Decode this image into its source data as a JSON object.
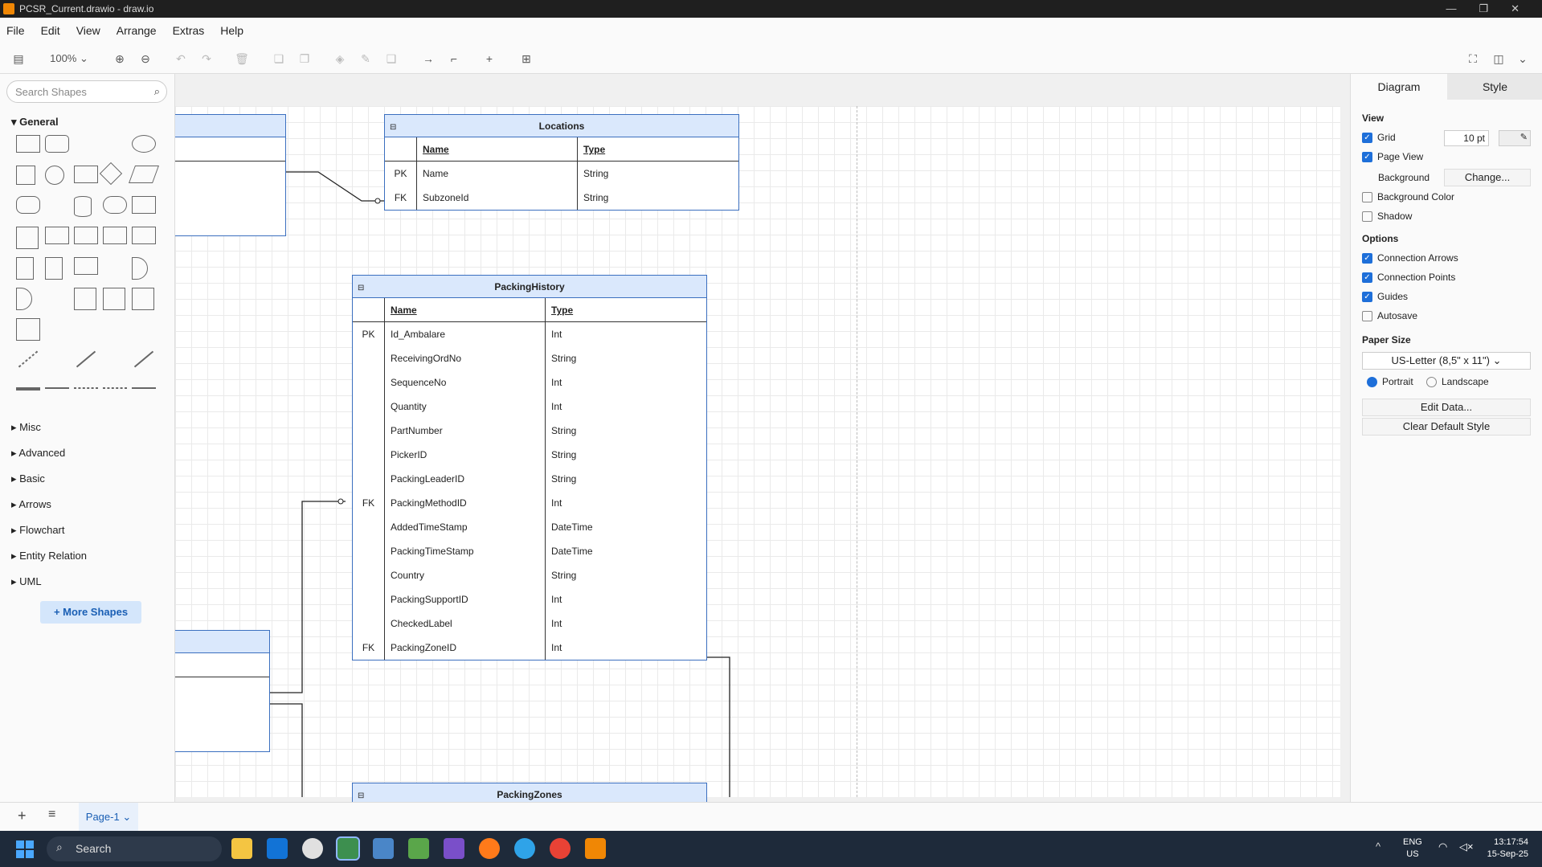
{
  "window": {
    "title": "PCSR_Current.drawio - draw.io"
  },
  "menu": [
    "File",
    "Edit",
    "View",
    "Arrange",
    "Extras",
    "Help"
  ],
  "toolbar": {
    "zoom": "100%"
  },
  "sidebar": {
    "search_placeholder": "Search Shapes",
    "general_label": "General",
    "sections": [
      "Misc",
      "Advanced",
      "Basic",
      "Arrows",
      "Flowchart",
      "Entity Relation",
      "UML"
    ],
    "more_shapes": "+ More Shapes"
  },
  "tables": {
    "locations": {
      "title": "Locations",
      "head": [
        "",
        "Name",
        "Type"
      ],
      "rows": [
        [
          "PK",
          "Name",
          "String"
        ],
        [
          "FK",
          "SubzoneId",
          "String"
        ]
      ]
    },
    "packing_history": {
      "title": "PackingHistory",
      "head": [
        "",
        "Name",
        "Type"
      ],
      "rows": [
        [
          "PK",
          "Id_Ambalare",
          "Int"
        ],
        [
          "",
          "ReceivingOrdNo",
          "String"
        ],
        [
          "",
          "SequenceNo",
          "Int"
        ],
        [
          "",
          "Quantity",
          "Int"
        ],
        [
          "",
          "PartNumber",
          "String"
        ],
        [
          "",
          "PickerID",
          "String"
        ],
        [
          "",
          "PackingLeaderID",
          "String"
        ],
        [
          "FK",
          "PackingMethodID",
          "Int"
        ],
        [
          "",
          "AddedTimeStamp",
          "DateTime"
        ],
        [
          "",
          "PackingTimeStamp",
          "DateTime"
        ],
        [
          "",
          "Country",
          "String"
        ],
        [
          "",
          "PackingSupportID",
          "Int"
        ],
        [
          "",
          "CheckedLabel",
          "Int"
        ],
        [
          "FK",
          "PackingZoneID",
          "Int"
        ]
      ]
    },
    "packing_zones": {
      "title": "PackingZones"
    }
  },
  "right_panel": {
    "tabs": [
      "Diagram",
      "Style"
    ],
    "view_label": "View",
    "grid": "Grid",
    "grid_size": "10 pt",
    "page_view": "Page View",
    "background": "Background",
    "change": "Change...",
    "background_color": "Background Color",
    "shadow": "Shadow",
    "options_label": "Options",
    "connection_arrows": "Connection Arrows",
    "connection_points": "Connection Points",
    "guides": "Guides",
    "autosave": "Autosave",
    "paper_size_label": "Paper Size",
    "paper_size": "US-Letter (8,5\" x 11\")",
    "portrait": "Portrait",
    "landscape": "Landscape",
    "edit_data": "Edit Data...",
    "clear_default_style": "Clear Default Style"
  },
  "bottom": {
    "page_tab": "Page-1"
  },
  "taskbar": {
    "search": "Search",
    "lang1": "ENG",
    "lang2": "US",
    "time": "13:17:54",
    "date": "15-Sep-25"
  }
}
